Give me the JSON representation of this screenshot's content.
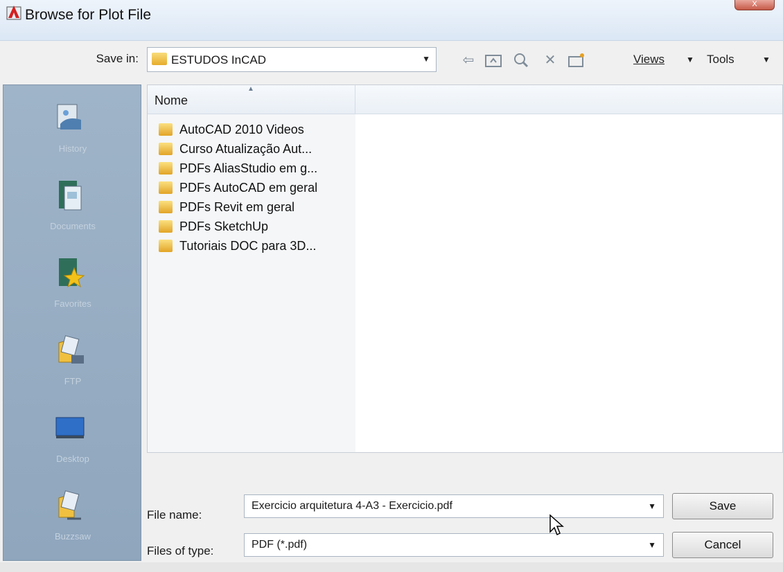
{
  "window": {
    "title": "Browse for Plot File",
    "close_label": "X"
  },
  "toolbar": {
    "save_in_label": "Save in:",
    "save_in_value": "ESTUDOS InCAD",
    "back_icon": "back-arrow-icon",
    "up_icon": "up-folder-icon",
    "search_icon": "search-web-icon",
    "delete_icon": "delete-icon",
    "new_folder_icon": "new-folder-icon",
    "views_label": "Views",
    "tools_label": "Tools"
  },
  "places": [
    {
      "label": "History",
      "icon": "history-icon"
    },
    {
      "label": "Documents",
      "icon": "documents-icon"
    },
    {
      "label": "Favorites",
      "icon": "favorites-icon"
    },
    {
      "label": "FTP",
      "icon": "ftp-icon"
    },
    {
      "label": "Desktop",
      "icon": "desktop-icon"
    },
    {
      "label": "Buzzsaw",
      "icon": "buzzsaw-icon"
    }
  ],
  "file_list": {
    "column_header": "Nome",
    "items": [
      "AutoCAD 2010 Videos",
      "Curso Atualização Aut...",
      "PDFs AliasStudio em g...",
      "PDFs AutoCAD em geral",
      "PDFs Revit em geral",
      "PDFs SketchUp",
      "Tutoriais DOC para 3D..."
    ]
  },
  "form": {
    "file_name_label": "File name:",
    "file_name_value": "Exercicio arquitetura 4-A3 - Exercicio.pdf",
    "file_type_label": "Files of type:",
    "file_type_value": "PDF (*.pdf)",
    "save_label": "Save",
    "cancel_label": "Cancel"
  },
  "colors": {
    "places_bg": "#9fb4c8",
    "folder": "#f0c040",
    "close": "#c65a48"
  }
}
